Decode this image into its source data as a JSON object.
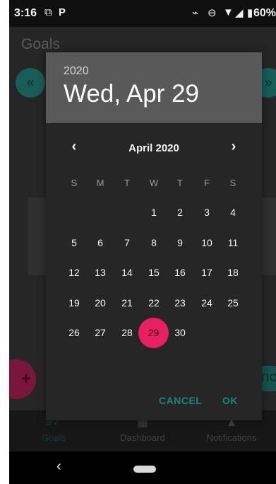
{
  "status": {
    "time": "3:16",
    "battery": "60%",
    "icons": [
      "cast-icon",
      "parking-icon",
      "silent-icon",
      "dnd-icon",
      "wifi-icon",
      "signal-icon",
      "battery-icon"
    ]
  },
  "app": {
    "page_title": "Goals",
    "fab_label": "+",
    "partial_button_label": "TION",
    "nav_tabs": [
      {
        "label": "Goals",
        "icon": "goals-icon"
      },
      {
        "label": "Dashboard",
        "icon": "dashboard-icon"
      },
      {
        "label": "Notifications",
        "icon": "notifications-icon"
      }
    ]
  },
  "date_picker": {
    "year": "2020",
    "selected_date_text": "Wed, Apr 29",
    "month_label": "April 2020",
    "prev_month_icon": "‹",
    "next_month_icon": "›",
    "weekdays": [
      "S",
      "M",
      "T",
      "W",
      "T",
      "F",
      "S"
    ],
    "days": [
      "",
      "",
      "",
      "1",
      "2",
      "3",
      "4",
      "5",
      "6",
      "7",
      "8",
      "9",
      "10",
      "11",
      "12",
      "13",
      "14",
      "15",
      "16",
      "17",
      "18",
      "19",
      "20",
      "21",
      "22",
      "23",
      "24",
      "25",
      "26",
      "27",
      "28",
      "29",
      "30",
      "",
      ""
    ],
    "selected_day": "29",
    "cancel_label": "CANCEL",
    "ok_label": "OK",
    "accent_color": "#e91e63",
    "action_color": "#158a7b"
  },
  "system_nav": {
    "back_icon": "‹"
  }
}
